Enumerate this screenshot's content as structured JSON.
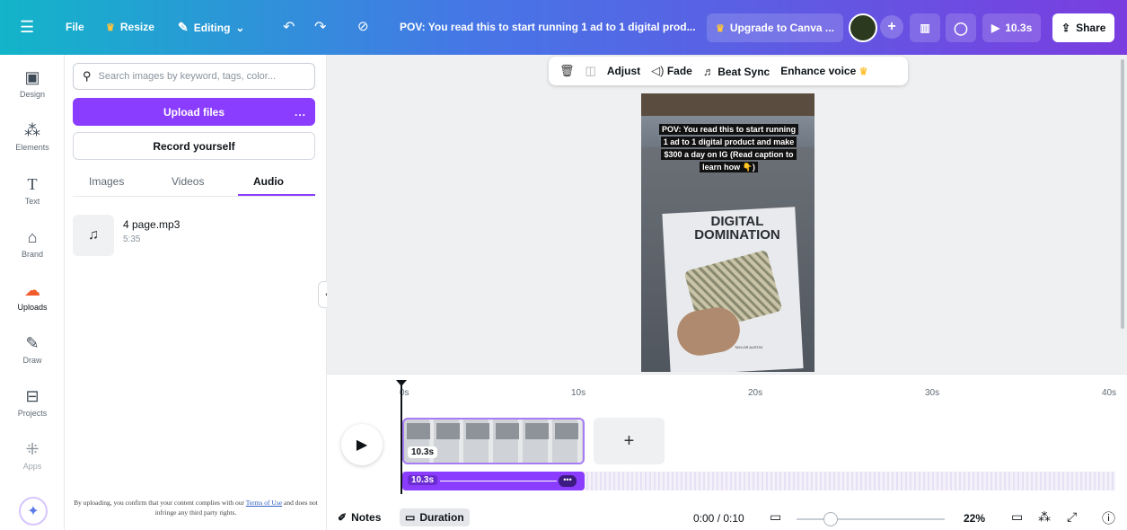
{
  "topbar": {
    "menu_icon": "hamburger-icon",
    "file": "File",
    "resize": "Resize",
    "editing": "Editing",
    "title": "POV: You read this to start running 1 ad to 1 digital prod...",
    "upgrade": "Upgrade to Canva ...",
    "avatar_plus": "+",
    "play_duration": "10.3s",
    "share": "Share"
  },
  "rail": [
    {
      "label": "Design",
      "icon": "design-icon"
    },
    {
      "label": "Elements",
      "icon": "elements-icon"
    },
    {
      "label": "Text",
      "icon": "text-icon"
    },
    {
      "label": "Brand",
      "icon": "brand-icon"
    },
    {
      "label": "Uploads",
      "icon": "uploads-icon"
    },
    {
      "label": "Draw",
      "icon": "draw-icon"
    },
    {
      "label": "Projects",
      "icon": "projects-icon"
    },
    {
      "label": "Apps",
      "icon": "apps-icon"
    }
  ],
  "panel": {
    "search_placeholder": "Search images by keyword, tags, color...",
    "upload_files": "Upload files",
    "upload_more": "...",
    "record_yourself": "Record yourself",
    "tabs": [
      "Images",
      "Videos",
      "Audio"
    ],
    "active_tab": "Audio",
    "audio_item": {
      "name": "4 page.mp3",
      "duration": "5:35"
    },
    "legal_prefix": "By uploading, you confirm that your content complies with our",
    "legal_link": "Terms of Use",
    "legal_suffix": "and does not infringe any third party rights."
  },
  "context_toolbar": {
    "adjust": "Adjust",
    "fade": "Fade",
    "beat_sync": "Beat Sync",
    "enhance_voice": "Enhance voice"
  },
  "page": {
    "caption": "POV: You read this to start running 1 ad to 1 digital product and make $300 a day on IG (Read caption to learn how 👇)",
    "book_title": "DIGITAL DOMINATION",
    "author": "TAYLOR AUSTIN"
  },
  "timeline": {
    "ticks": [
      "0s",
      "10s",
      "20s",
      "30s",
      "40s"
    ],
    "clip_duration": "10.3s",
    "audio_duration": "10.3s",
    "add": "+"
  },
  "bottom": {
    "notes": "Notes",
    "duration": "Duration",
    "time": "0:00 / 0:10",
    "zoom": "22%"
  },
  "colors": {
    "accent": "#8b3dff",
    "topbar_start": "#12b5c9",
    "topbar_end": "#7a3de0"
  }
}
